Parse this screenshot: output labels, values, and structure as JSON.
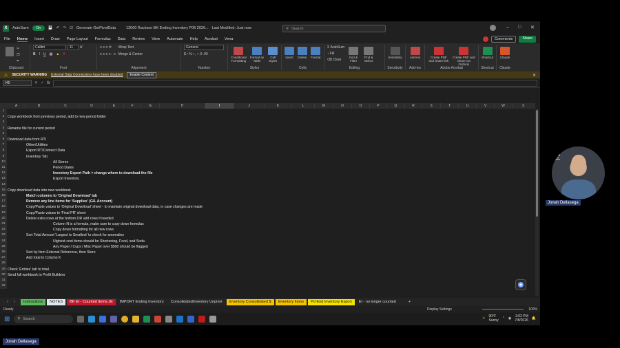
{
  "titlebar": {
    "autosave_label": "AutoSave",
    "autosave_state": "On",
    "addin": "Generate GetPivotData",
    "filename": "13000 Rackson BK Ending Inventory P06 2026...",
    "modified": "Last Modified: Just now",
    "search_placeholder": "Search"
  },
  "menu": {
    "items": [
      "File",
      "Home",
      "Insert",
      "Draw",
      "Page Layout",
      "Formulas",
      "Data",
      "Review",
      "View",
      "Automate",
      "Help",
      "Acrobat",
      "Vena"
    ],
    "comments": "Comments",
    "share": "Share"
  },
  "ribbon": {
    "font_name": "Calibri",
    "font_size": "11",
    "wrap_text": "Wrap Text",
    "merge_center": "Merge & Center",
    "number_format": "General",
    "conditional": "Conditional Formatting",
    "format_table": "Format as Table",
    "cell_styles": "Cell Styles",
    "insert": "Insert",
    "delete": "Delete",
    "format": "Format",
    "autosum": "AutoSum",
    "fill": "Fill",
    "clear": "Clear",
    "sort_filter": "Sort & Filter",
    "find_select": "Find & Select",
    "sensitivity": "Sensitivity",
    "addins": "Add-ins",
    "create_pdf": "Create PDF and Share link",
    "create_pdf_outlook": "Create PDF and Share via Outlook",
    "shortcut": "Shortcut",
    "claude": "Claude",
    "groups": [
      "Clipboard",
      "Font",
      "Alignment",
      "Number",
      "Styles",
      "Cells",
      "Editing",
      "Sensitivity",
      "Add-ins",
      "Adobe Acrobat",
      "Shortcut",
      "Claude"
    ]
  },
  "warning": {
    "title": "SECURITY WARNING",
    "message": "External Data Connections have been disabled",
    "button": "Enable Content"
  },
  "formula": {
    "namebox": "I45",
    "fx": "fx"
  },
  "columns": [
    "A",
    "B",
    "C",
    "D",
    "E",
    "F",
    "G",
    "H",
    "I",
    "J",
    "K",
    "L",
    "M",
    "N",
    "O",
    "P",
    "Q",
    "R",
    "S",
    "T",
    "U",
    "V",
    "W",
    "X"
  ],
  "rows": [
    {
      "n": "1",
      "text": "",
      "indent": 0,
      "bold": false
    },
    {
      "n": "2",
      "text": "Copy workbook from previous period, add to new period folder",
      "indent": 0,
      "bold": false
    },
    {
      "n": "3",
      "text": "",
      "indent": 0,
      "bold": false
    },
    {
      "n": "4",
      "text": "Rename file for current period",
      "indent": 0,
      "bold": false
    },
    {
      "n": "5",
      "text": "",
      "indent": 0,
      "bold": false
    },
    {
      "n": "6",
      "text": "Download data from RTI",
      "indent": 0,
      "bold": false
    },
    {
      "n": "7",
      "text": "Other/Utilities",
      "indent": 1,
      "bold": false
    },
    {
      "n": "8",
      "text": "Export RTIConnect Data",
      "indent": 1,
      "bold": false
    },
    {
      "n": "9",
      "text": "Inventory Tab",
      "indent": 1,
      "bold": false
    },
    {
      "n": "10",
      "text": "All Stores",
      "indent": 2,
      "bold": false
    },
    {
      "n": "11",
      "text": "Period Dates",
      "indent": 2,
      "bold": false
    },
    {
      "n": "12",
      "text": "Inventory Export Path > change where to download the file",
      "indent": 2,
      "bold": true
    },
    {
      "n": "13",
      "text": "Export Inventory",
      "indent": 2,
      "bold": false
    },
    {
      "n": "14",
      "text": "",
      "indent": 0,
      "bold": false
    },
    {
      "n": "15",
      "text": "Copy download data into new workbook",
      "indent": 0,
      "bold": false
    },
    {
      "n": "16",
      "text": "Match columns to 'Original Download' tab",
      "indent": 1,
      "bold": true
    },
    {
      "n": "17",
      "text": "Remove any line items for 'Supplies' (G/L Account)",
      "indent": 1,
      "bold": true
    },
    {
      "n": "18",
      "text": "Copy/Paste values to 'Original Download' sheet - to maintain original download data, in case changes are made",
      "indent": 1,
      "bold": false
    },
    {
      "n": "19",
      "text": "Copy/Paste values to 'Final PR' sheet",
      "indent": 1,
      "bold": false
    },
    {
      "n": "20",
      "text": "Delete extra rows at the bottom OR add rows if needed",
      "indent": 1,
      "bold": false
    },
    {
      "n": "21",
      "text": "Column N is a formula, make sure to copy down formulas",
      "indent": 2,
      "bold": false
    },
    {
      "n": "22",
      "text": "Copy down formatting for all new rows",
      "indent": 2,
      "bold": false
    },
    {
      "n": "23",
      "text": "Sort Total Amount 'Largest to Smallest' to check for anomalies",
      "indent": 1,
      "bold": false
    },
    {
      "n": "24",
      "text": "Highest-cost items should be Shortening, Food, and Soda",
      "indent": 2,
      "bold": false
    },
    {
      "n": "25",
      "text": "Any Paper / Cups / Misc Paper over $500 should be flagged",
      "indent": 2,
      "bold": false
    },
    {
      "n": "26",
      "text": "Sort by Item External Reference, then Store",
      "indent": 1,
      "bold": false
    },
    {
      "n": "27",
      "text": "Add total to Column K",
      "indent": 1,
      "bold": false
    },
    {
      "n": "28",
      "text": "",
      "indent": 0,
      "bold": false
    },
    {
      "n": "29",
      "text": "Check 'Entries' tab to total",
      "indent": 0,
      "bold": false
    },
    {
      "n": "30",
      "text": "Send full workbook to Profit Builders",
      "indent": 0,
      "bold": false
    },
    {
      "n": "31",
      "text": "",
      "indent": 0,
      "bold": false
    },
    {
      "n": "32",
      "text": "",
      "indent": 0,
      "bold": false
    }
  ],
  "sheets": [
    {
      "label": "Instructions",
      "bg": "#5cb85c",
      "fg": "#111"
    },
    {
      "label": "NOTES",
      "bg": "#dfe8f0",
      "fg": "#111"
    },
    {
      "label": "BK EI - Counted Items JE",
      "bg": "#c0172a",
      "fg": "#fff"
    },
    {
      "label": "IMPORT Ending Inventory",
      "bg": "#242424",
      "fg": "#ddd"
    },
    {
      "label": "ConsolidatedInventory Unpivot",
      "bg": "#242424",
      "fg": "#ddd"
    },
    {
      "label": "Inventory Consolidated $",
      "bg": "#f5c400",
      "fg": "#111"
    },
    {
      "label": "Inventory Items",
      "bg": "#f5c400",
      "fg": "#111"
    },
    {
      "label": "Pd End Inventory Export",
      "bg": "#f5e200",
      "fg": "#111"
    },
    {
      "label": "EI - no longer counted",
      "bg": "#242424",
      "fg": "#ddd"
    }
  ],
  "status": {
    "ready": "Ready",
    "display_settings": "Display Settings",
    "zoom": "100%"
  },
  "taskbar": {
    "search": "Search",
    "weather_temp": "90°F",
    "weather_desc": "Sunny",
    "time": "3:02 PM",
    "date": "7/8/2026"
  },
  "presenter": {
    "name": "Jonah Dellasega",
    "bg_text": "FEABLE"
  },
  "colors": {
    "accent_green": "#107c41",
    "sheet_red": "#c0172a",
    "sheet_yellow": "#f5c400"
  }
}
